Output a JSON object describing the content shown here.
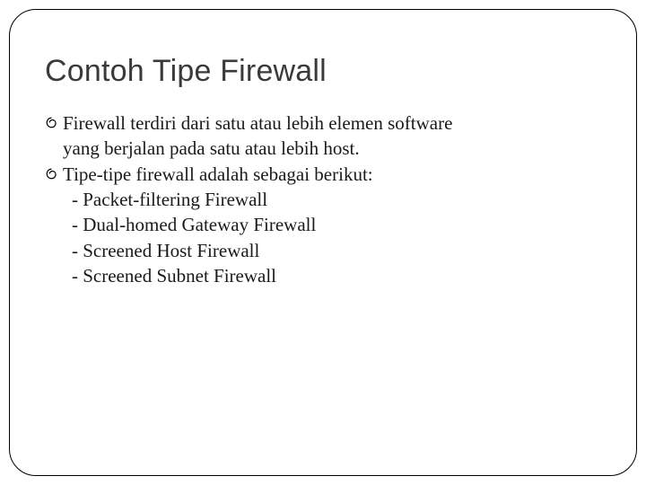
{
  "title": "Contoh Tipe Firewall",
  "bullets": [
    {
      "text": "Firewall terdiri dari satu atau lebih elemen software",
      "continuation": "yang berjalan pada satu atau lebih host."
    },
    {
      "text": "Tipe-tipe firewall adalah  sebagai berikut:",
      "sub": [
        "- Packet-filtering Firewall",
        "- Dual-homed Gateway Firewall",
        "- Screened Host Firewall",
        "- Screened Subnet Firewall"
      ]
    }
  ]
}
